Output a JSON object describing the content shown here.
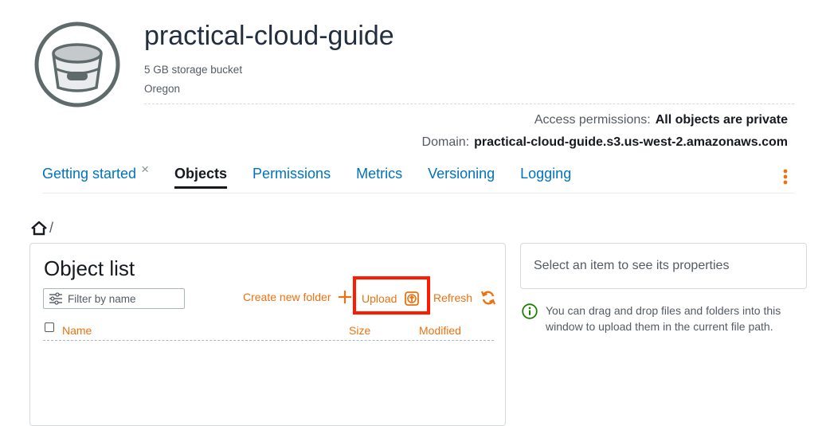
{
  "bucket": {
    "name": "practical-cloud-guide",
    "description": "5 GB storage bucket",
    "region": "Oregon",
    "access_label": "Access permissions:",
    "access_value": "All objects are private",
    "domain_label": "Domain:",
    "domain_value": "practical-cloud-guide.s3.us-west-2.amazonaws.com",
    "icon": "bucket-icon"
  },
  "tabs": [
    {
      "label": "Getting started",
      "closable": true
    },
    {
      "label": "Objects",
      "active": true
    },
    {
      "label": "Permissions"
    },
    {
      "label": "Metrics"
    },
    {
      "label": "Versioning"
    },
    {
      "label": "Logging"
    }
  ],
  "tab_close_glyph": "×",
  "breadcrumb": {
    "separator": "/",
    "icon": "home-icon"
  },
  "object_list": {
    "title": "Object list",
    "filter_placeholder": "Filter by name",
    "actions": {
      "create_folder": "Create new folder",
      "upload": "Upload",
      "refresh": "Refresh"
    },
    "columns": [
      "Name",
      "Size",
      "Modified"
    ],
    "rows": []
  },
  "properties": {
    "placeholder": "Select an item to see its properties",
    "info": "You can drag and drop files and folders into this window to upload them in the current file path."
  },
  "colors": {
    "accent": "#ec7211",
    "link": "#0073bb",
    "highlight": "#ff1a00",
    "info": "#1d8102"
  }
}
